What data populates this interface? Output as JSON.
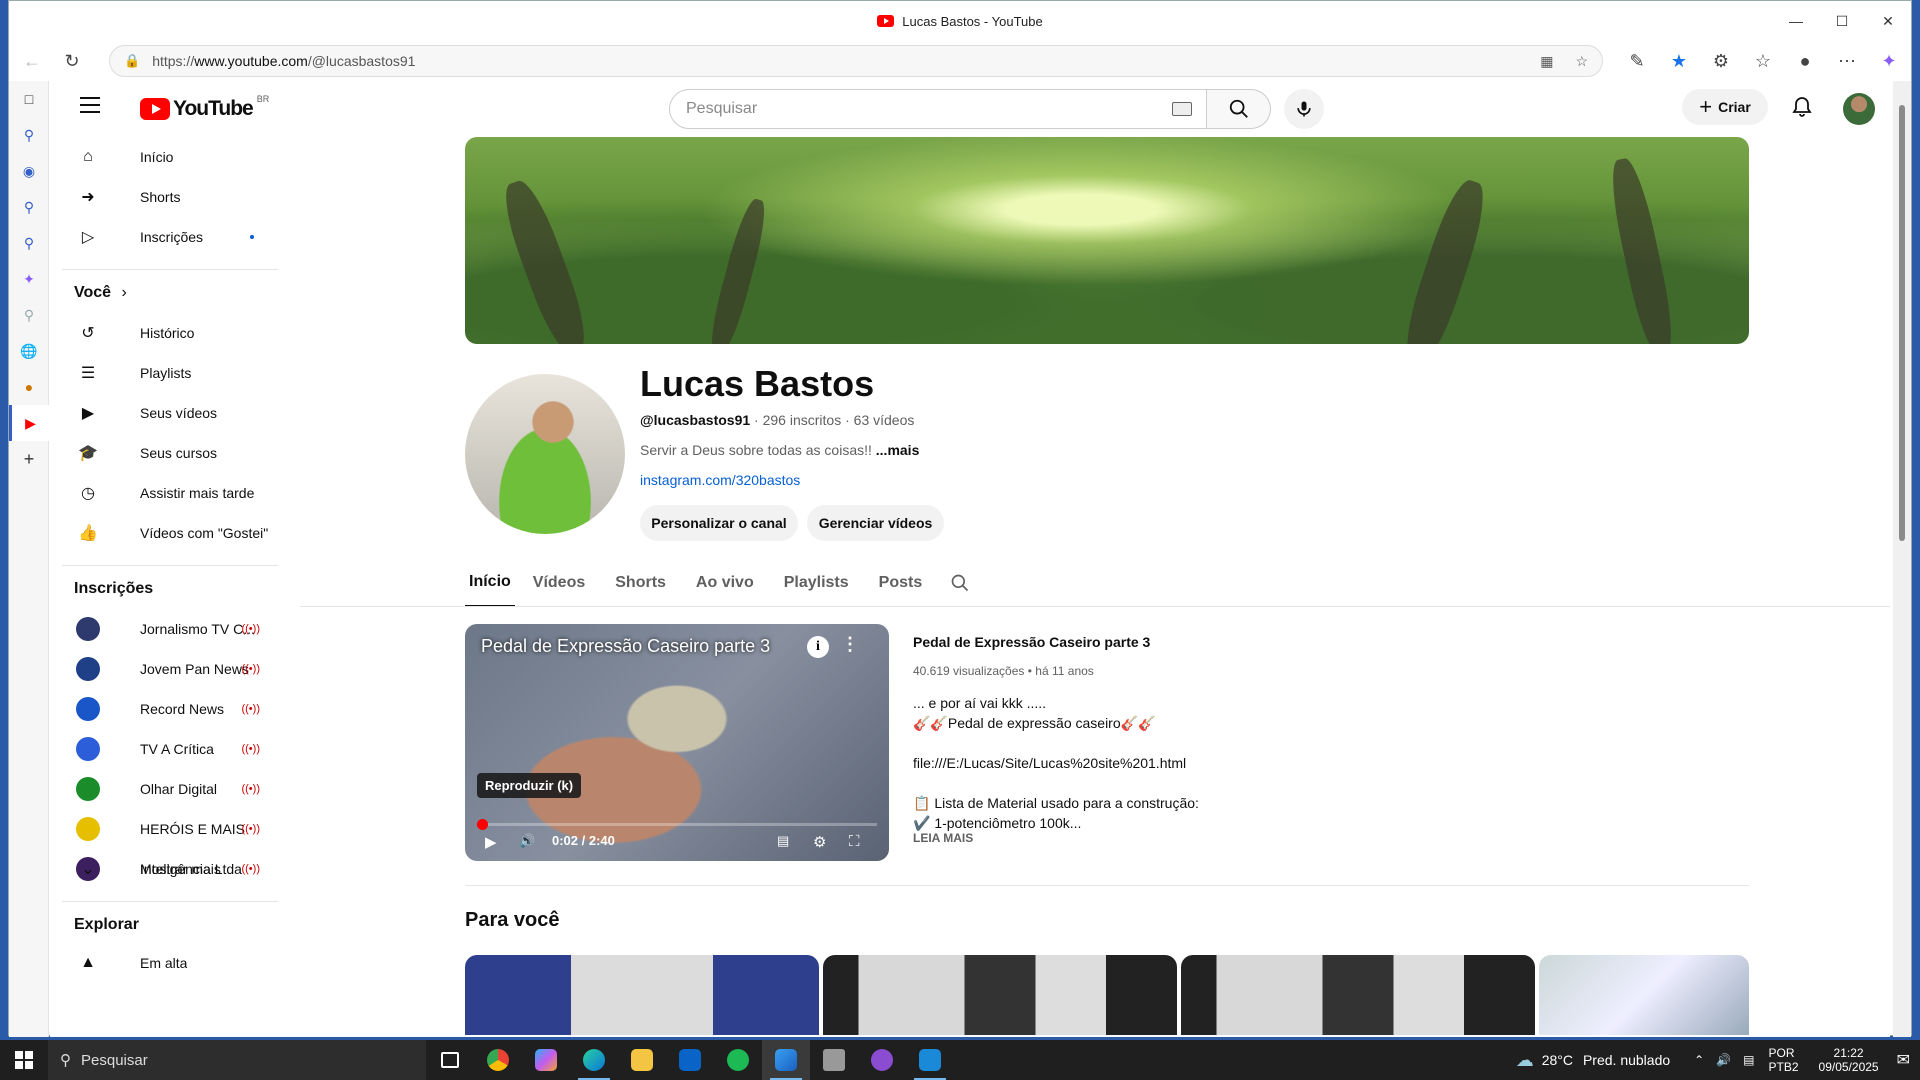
{
  "window": {
    "title": "Lucas Bastos - YouTube"
  },
  "browser": {
    "url_prefix": "https://",
    "url_host": "www.youtube.com",
    "url_path": "/@lucasbastos91"
  },
  "header": {
    "logo_text": "YouTube",
    "logo_region": "BR",
    "search_placeholder": "Pesquisar",
    "create_label": "Criar"
  },
  "sidebar": {
    "main": [
      {
        "label": "Início",
        "icon": "home-icon"
      },
      {
        "label": "Shorts",
        "icon": "shorts-icon"
      },
      {
        "label": "Inscrições",
        "icon": "subscriptions-icon"
      }
    ],
    "you_title": "Você",
    "you_items": [
      {
        "label": "Histórico",
        "icon": "history-icon"
      },
      {
        "label": "Playlists",
        "icon": "playlists-icon"
      },
      {
        "label": "Seus vídeos",
        "icon": "your-videos-icon"
      },
      {
        "label": "Seus cursos",
        "icon": "courses-icon"
      },
      {
        "label": "Assistir mais tarde",
        "icon": "watch-later-icon"
      },
      {
        "label": "Vídeos com \"Gostei\"",
        "icon": "like-icon"
      }
    ],
    "subs_title": "Inscrições",
    "subscriptions": [
      {
        "label": "Jornalismo TV C...",
        "color": "#2e3a6e"
      },
      {
        "label": "Jovem Pan News",
        "color": "#1f3f86"
      },
      {
        "label": "Record News",
        "color": "#1a56c8"
      },
      {
        "label": "TV A Crítica",
        "color": "#2b5ed8"
      },
      {
        "label": "Olhar Digital",
        "color": "#1a8c2a"
      },
      {
        "label": "HERÓIS E MAIS",
        "color": "#e6c000"
      },
      {
        "label": "Inteligência Ltda",
        "color": "#3b1f5e"
      }
    ],
    "show_more": "Mostrar mais",
    "explore_title": "Explorar",
    "explore_first": "Em alta"
  },
  "channel": {
    "name": "Lucas Bastos",
    "handle": "@lucasbastos91",
    "subscribers": "296 inscritos",
    "videos": "63 vídeos",
    "description": "Servir a Deus sobre todas as coisas!!",
    "more": "...mais",
    "link": "instagram.com/320bastos",
    "customize_button": "Personalizar o canal",
    "manage_button": "Gerenciar vídeos"
  },
  "tabs": [
    "Início",
    "Vídeos",
    "Shorts",
    "Ao vivo",
    "Playlists",
    "Posts"
  ],
  "featured": {
    "overlay_title": "Pedal de Expressão Caseiro parte 3",
    "tooltip": "Reproduzir (k)",
    "time": "0:02 / 2:40",
    "progress": 0.0125,
    "title": "Pedal de Expressão Caseiro parte  3",
    "views": "40.619 visualizações",
    "age": "há 11 anos",
    "description_lines": [
      "... e por aí vai kkk .....",
      "🎸🎸Pedal de expressão caseiro🎸🎸",
      "",
      "file:///E:/Lucas/Site/Lucas%20site%201.html",
      "",
      "📋 Lista de Material usado para a construção:",
      "✔️ 1-potenciômetro 100k..."
    ],
    "read_more": "LEIA MAIS"
  },
  "for_you_title": "Para você",
  "taskbar": {
    "search_placeholder": "Pesquisar",
    "weather_temp": "28°C",
    "weather_text": "Pred. nublado",
    "lang_top": "POR",
    "lang_bottom": "PTB2",
    "time": "21:22",
    "date": "09/05/2025"
  }
}
